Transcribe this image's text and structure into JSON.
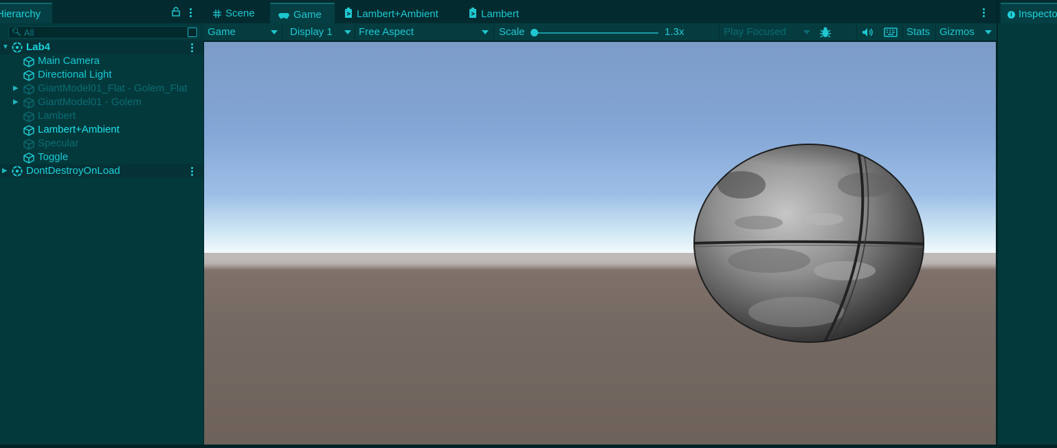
{
  "hierarchy": {
    "tab_label": "Hierarchy",
    "search_placeholder": "All",
    "scene": {
      "name": "Lab4"
    },
    "items": [
      {
        "label": "Main Camera",
        "state": "active",
        "expandable": false
      },
      {
        "label": "Directional Light",
        "state": "active",
        "expandable": false
      },
      {
        "label": "GiantModel01_Flat - Golem_Flat",
        "state": "inactive",
        "expandable": true
      },
      {
        "label": "GiantModel01 - Golem",
        "state": "inactive",
        "expandable": true
      },
      {
        "label": "Lambert",
        "state": "inactive",
        "expandable": false
      },
      {
        "label": "Lambert+Ambient",
        "state": "selected",
        "expandable": false
      },
      {
        "label": "Specular",
        "state": "inactive",
        "expandable": false
      },
      {
        "label": "Toggle",
        "state": "active",
        "expandable": false
      }
    ],
    "dont_destroy": {
      "name": "DontDestroyOnLoad"
    }
  },
  "tabs": [
    {
      "label": "Scene",
      "icon": "grid-icon"
    },
    {
      "label": "Game",
      "icon": "gamepad-icon",
      "active": true
    },
    {
      "label": "Lambert+Ambient",
      "icon": "shader-icon"
    },
    {
      "label": "Lambert",
      "icon": "shader-icon"
    }
  ],
  "toolbar": {
    "mode": "Game",
    "display": "Display 1",
    "aspect": "Free Aspect",
    "scale_label": "Scale",
    "scale_value": "1.3x",
    "play_mode": "Play Focused",
    "stats": "Stats",
    "gizmos": "Gizmos"
  },
  "inspector": {
    "tab_label": "Inspector"
  },
  "colors": {
    "panel_bg": "#04393c",
    "tabbar_bg": "#032b2f",
    "accent_text": "#1fc7d0",
    "dim_text": "#0a6c72"
  }
}
